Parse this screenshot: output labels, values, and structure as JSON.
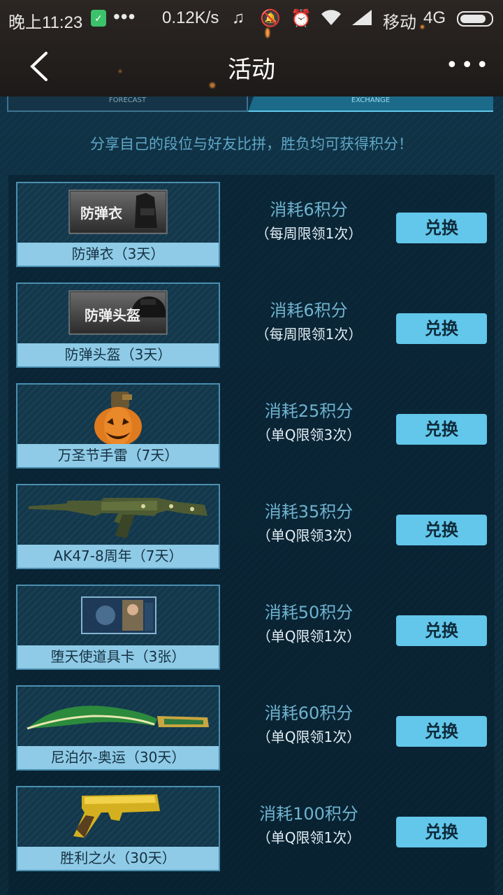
{
  "status_bar": {
    "time": "晚上11:23",
    "dots": "•••",
    "speed": "0.12K/s",
    "carrier": "移动",
    "network": "4G"
  },
  "header": {
    "title": "活动",
    "more": "•••"
  },
  "tabs": {
    "left": "FORECAST",
    "right": "EXCHANGE"
  },
  "notice": "分享自己的段位与好友比拼，胜负均可获得积分！",
  "items": [
    {
      "name": "防弹衣（3天）",
      "badge": "防弹衣",
      "cost": "消耗6积分",
      "limit": "（每周限领1次）",
      "button": "兑换",
      "icon": "vest-icon"
    },
    {
      "name": "防弹头盔（3天）",
      "badge": "防弹头盔",
      "cost": "消耗6积分",
      "limit": "（每周限领1次）",
      "button": "兑换",
      "icon": "helmet-icon"
    },
    {
      "name": "万圣节手雷（7天）",
      "cost": "消耗25积分",
      "limit": "（单Q限领3次）",
      "button": "兑换",
      "icon": "pumpkin-grenade-icon"
    },
    {
      "name": "AK47-8周年（7天）",
      "cost": "消耗35积分",
      "limit": "（单Q限领3次）",
      "button": "兑换",
      "icon": "rifle-icon"
    },
    {
      "name": "堕天使道具卡（3张）",
      "cost": "消耗50积分",
      "limit": "（单Q限领1次）",
      "button": "兑换",
      "icon": "item-card-icon"
    },
    {
      "name": "尼泊尔-奥运（30天）",
      "cost": "消耗60积分",
      "limit": "（单Q限领1次）",
      "button": "兑换",
      "icon": "knife-icon"
    },
    {
      "name": "胜利之火（30天）",
      "cost": "消耗100积分",
      "limit": "（单Q限领1次）",
      "button": "兑换",
      "icon": "pistol-icon"
    }
  ]
}
